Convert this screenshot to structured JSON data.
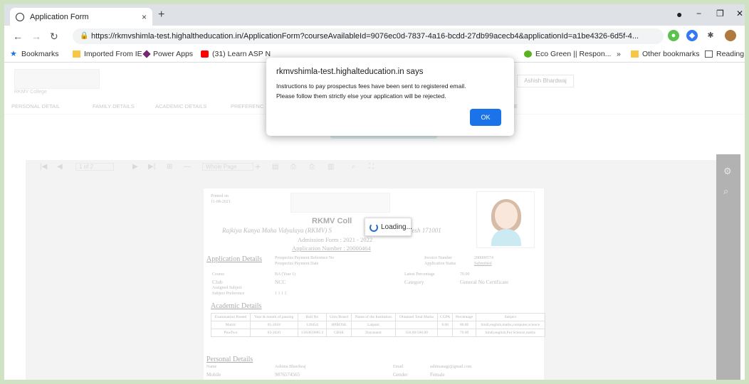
{
  "browser": {
    "tab_title": "Application Form",
    "tab_close": "×",
    "new_tab": "+",
    "minimize": "−",
    "restore": "❐",
    "close": "✕",
    "url": "https://rkmvshimla-test.highaltheducation.in/ApplicationForm?courseAvailableId=9076ec0d-7837-4a16-bcdd-27db99acecb4&applicationId=a1be4326-6d5f-4..."
  },
  "bookmarks": [
    {
      "label": "Bookmarks",
      "icon": "star-icon",
      "color": "#1a73e8"
    },
    {
      "label": "Imported From IE",
      "icon": "folder-icon",
      "color": "#f6c644"
    },
    {
      "label": "Power Apps",
      "icon": "power-apps-icon",
      "color": "#742774"
    },
    {
      "label": "(31) Learn ASP N",
      "icon": "youtube-icon",
      "color": "#ff0000"
    },
    {
      "label": "Eco Green || Respon...",
      "icon": "leaf-icon",
      "color": "#5bb21f"
    },
    {
      "label": "»",
      "icon": "",
      "color": ""
    },
    {
      "label": "Other bookmarks",
      "icon": "folder-icon",
      "color": "#f6c644"
    },
    {
      "label": "Reading l",
      "icon": "reading-list-icon",
      "color": "#555"
    }
  ],
  "page": {
    "college_short": "RKMV College",
    "user_name": "Ashish Bhardwaj",
    "nav_tabs": [
      "PERSONAL DETAIL",
      "FAMILY DETAILS",
      "ACADEMIC DETAILS",
      "PREFERENC",
      "E"
    ]
  },
  "viewer": {
    "page_box": "1 of 2",
    "zoom": "Whole Page",
    "loading": "Loading..."
  },
  "document": {
    "printed_on_label": "Printed on",
    "printed_on_date": "11-08-2021",
    "college_name": "RKMV Coll",
    "college_full": "Rajkiya Kanya Maha Vidyalaya (RKMV) S",
    "college_full_tail": "radesh 171001",
    "admission_form": "Admission Form : 2021 - 2022",
    "application_number": "Application Number : 20000464",
    "section_application": "Application Details",
    "prospectus_ref": "Prospectus Payment Reference No",
    "prospectus_date": "Prospectus Payment Date",
    "invoice_label": "Invoice Number",
    "invoice_value": "200000574",
    "status_label": "Application Status",
    "status_value": "Submitted",
    "course_label": "Course",
    "course_value": "BA (Year 1)",
    "club_label": "Club",
    "club_value": "NCC",
    "assigned_label": "Assigned Subject",
    "subjpref_label": "Subject Preference",
    "subjpref_value": "1 1 1 1",
    "latest_pct_label": "Latest Percentage",
    "latest_pct_value": "70.00",
    "category_label": "Category",
    "category_value": "General No Certificate",
    "section_academic": "Academic Details",
    "academic_headers": [
      "Examination Passed",
      "Year & month of passing",
      "Roll No",
      "Univ/Board",
      "Name of the Institution",
      "Obtained Total Marks",
      "CGPA",
      "Percentage",
      "Subject"
    ],
    "academic_rows": [
      [
        "Matric",
        "01-2018",
        "120454",
        "HPBOSE",
        "Lalpani",
        "",
        "8.00",
        "80.00",
        "hindi,english,maths,computer,science"
      ],
      [
        "PlusTwo",
        "03-2020",
        "1585859085 2",
        "CBSE",
        "Dayanand",
        "350.00/500.00",
        "",
        "70.00",
        "hindi,english,Pol Science,maths"
      ]
    ],
    "section_personal": "Personal Details",
    "name_label": "Name",
    "name_value": "Ashima Bhardwaj",
    "mobile_label": "Mobile",
    "mobile_value": "9876574565",
    "email_label": "Email",
    "email_value": "ashimanagi@gmail.com",
    "gender_label": "Gender",
    "gender_value": "Female"
  },
  "dialog": {
    "title": "rkmvshimla-test.highalteducation.in says",
    "message": "Instructions to pay prospectus fees have been sent to registered email.\nPlease follow them strictly else your application will be rejected.",
    "ok": "OK"
  }
}
